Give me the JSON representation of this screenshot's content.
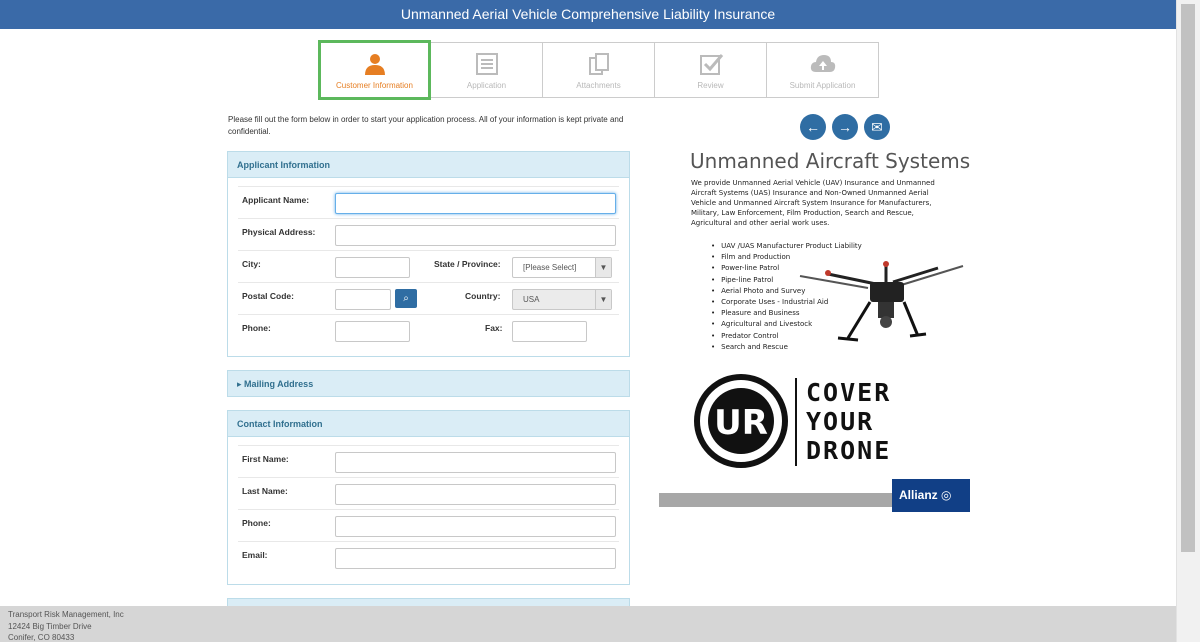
{
  "header": {
    "title": "Unmanned Aerial Vehicle Comprehensive Liability Insurance"
  },
  "steps": [
    {
      "label": "Customer Information",
      "icon": "person-icon",
      "active": true
    },
    {
      "label": "Application",
      "icon": "document-icon",
      "active": false
    },
    {
      "label": "Attachments",
      "icon": "attachments-icon",
      "active": false
    },
    {
      "label": "Review",
      "icon": "check-icon",
      "active": false
    },
    {
      "label": "Submit Application",
      "icon": "cloud-upload-icon",
      "active": false
    }
  ],
  "intro": "Please fill out the form below in order to start your application process. All of your information is kept private and confidential.",
  "applicant": {
    "heading": "Applicant Information",
    "name_label": "Applicant Name:",
    "address_label": "Physical Address:",
    "city_label": "City:",
    "state_label": "State / Province:",
    "state_value": "[Please Select]",
    "postal_label": "Postal Code:",
    "country_label": "Country:",
    "country_value": "USA",
    "phone_label": "Phone:",
    "fax_label": "Fax:"
  },
  "mailing": {
    "heading": "▸ Mailing Address"
  },
  "contact": {
    "heading": "Contact Information",
    "first_label": "First Name:",
    "last_label": "Last Name:",
    "phone_label": "Phone:",
    "email_label": "Email:"
  },
  "promo": {
    "title": "Unmanned Aircraft Systems",
    "description": "We provide Unmanned Aerial Vehicle (UAV) Insurance and Unmanned Aircraft Systems (UAS) Insurance and Non-Owned Unmanned Aerial Vehicle and Unmanned Aircraft System Insurance for Manufacturers, Military, Law Enforcement, Film Production, Search and Rescue, Agricultural and other aerial work uses.",
    "items": [
      "UAV /UAS Manufacturer Product Liability",
      "Film and Production",
      "Power-line Patrol",
      "Pipe-line Patrol",
      "Aerial Photo and Survey",
      "Corporate Uses - Industrial Aid",
      "Pleasure and Business",
      "Agricultural and Livestock",
      "Predator Control",
      "Search and Rescue"
    ],
    "logo_words": [
      "COVER",
      "YOUR",
      "DRONE"
    ],
    "partner": "Allianz"
  },
  "footer": {
    "line1": "Transport Risk Management, Inc",
    "line2": "12424 Big Timber Drive",
    "line3": "Conifer, CO 80433"
  },
  "colors": {
    "header": "#3a6aa8",
    "accent": "#2f6da3",
    "active_step": "#5cb85c",
    "panel_head": "#daedf6"
  }
}
